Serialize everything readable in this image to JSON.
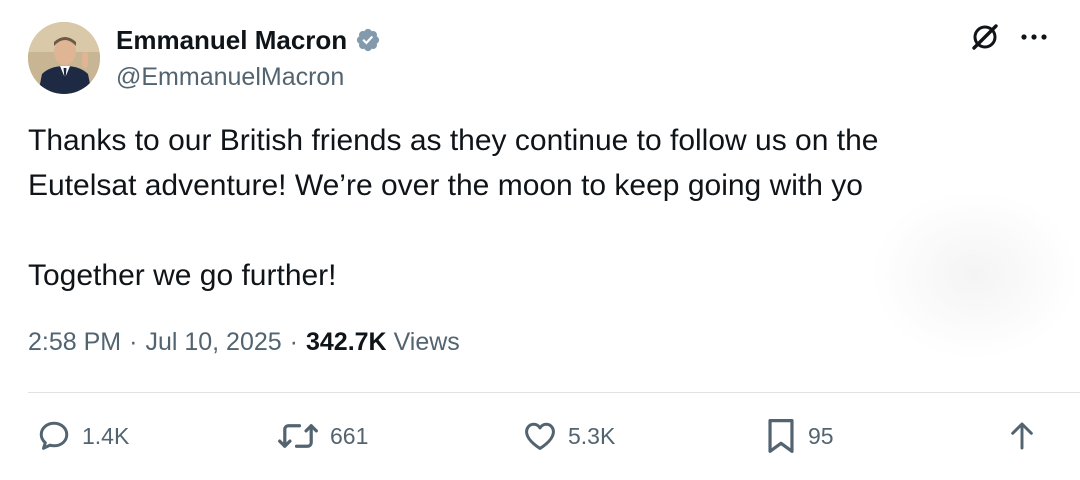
{
  "author": {
    "display_name": "Emmanuel Macron",
    "handle": "@EmmanuelMacron",
    "verified_icon": "verified-badge-icon",
    "avatar_icon": "avatar-photo"
  },
  "top_actions": {
    "grok_icon": "grok-icon",
    "more_icon": "more-icon"
  },
  "tweet": {
    "line1": "Thanks to our British friends as they continue to follow us on the",
    "line2": "Eutelsat adventure! We’re over the moon to keep going with yo",
    "line3": "",
    "line4": "Together we go further!"
  },
  "meta": {
    "time": "2:58 PM",
    "sep1": "·",
    "date": "Jul 10, 2025",
    "sep2": "·",
    "views_count": "342.7K",
    "views_label": "Views"
  },
  "actions": {
    "replies": "1.4K",
    "reposts": "661",
    "likes": "5.3K",
    "bookmarks": "95"
  },
  "colors": {
    "text": "#0f1419",
    "secondary": "#536471",
    "verified": "#829aab",
    "divider": "#dfe3e6"
  }
}
